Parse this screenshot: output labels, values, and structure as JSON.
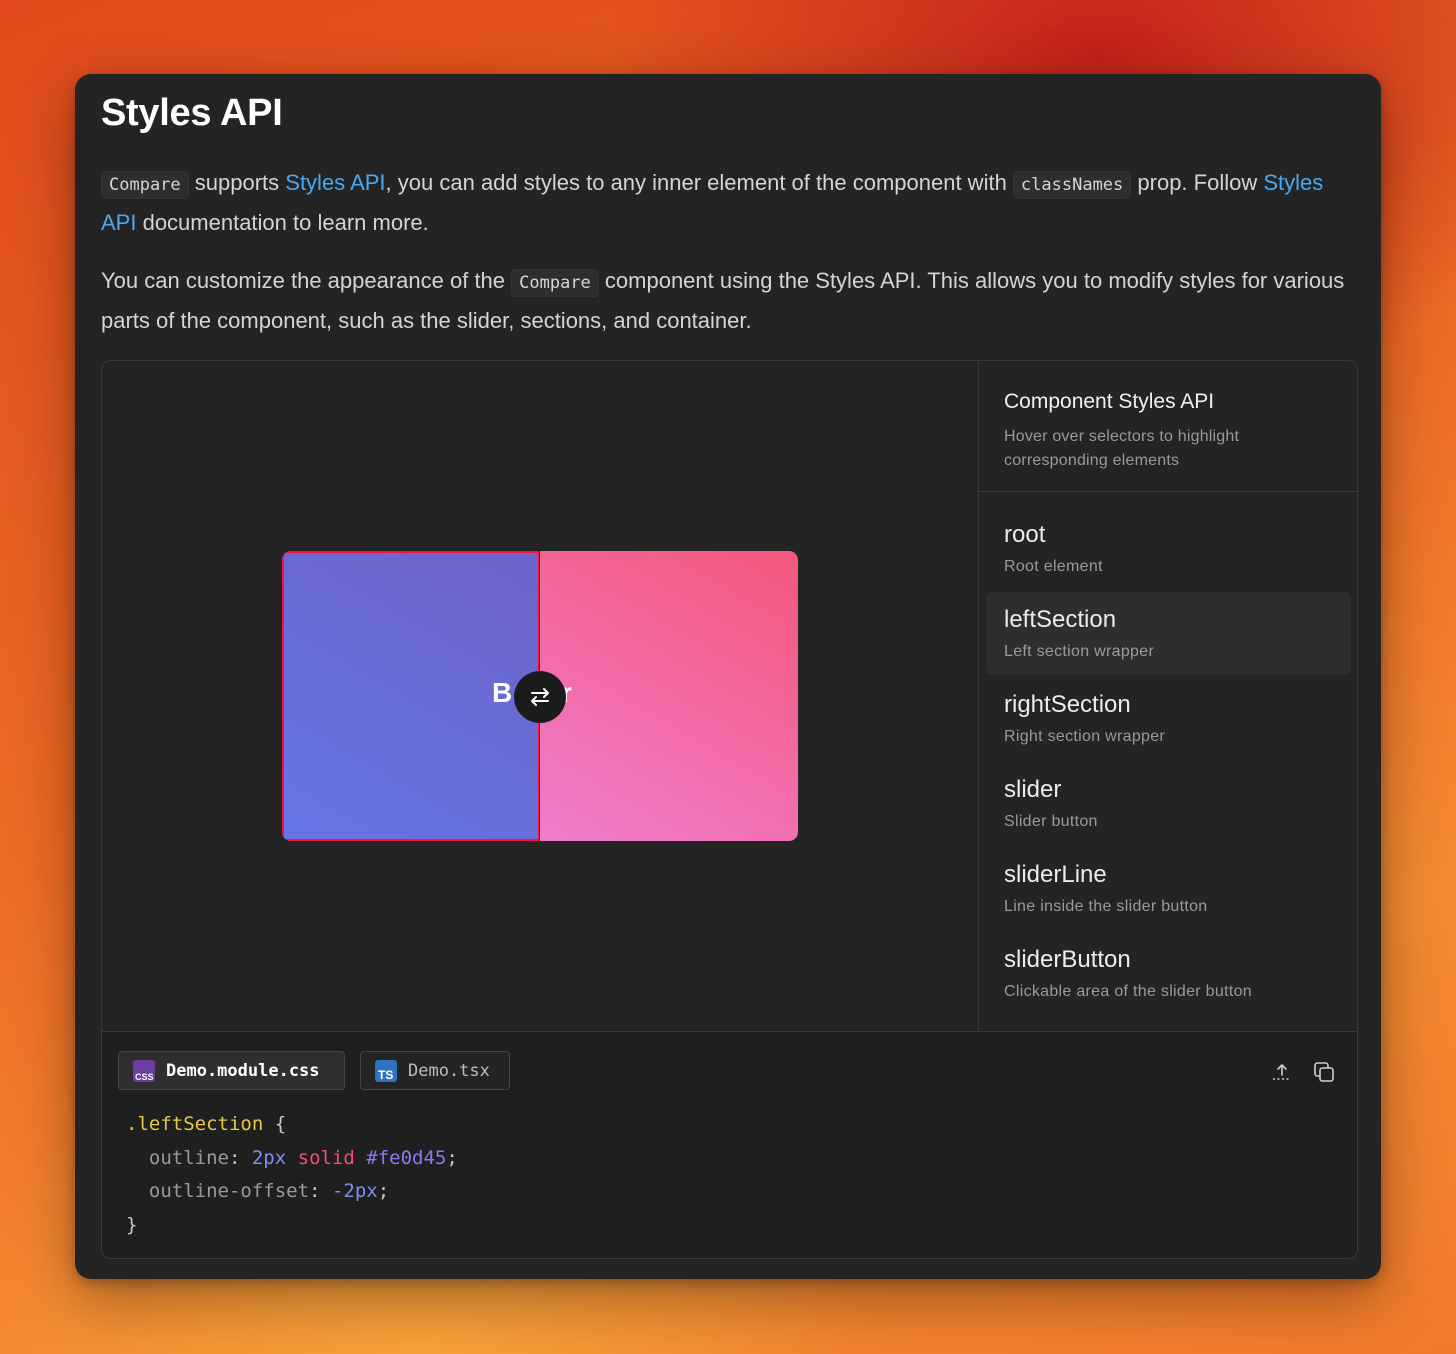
{
  "page": {
    "title": "Styles API",
    "p1": {
      "code1": "Compare",
      "t1": " supports ",
      "link1": "Styles API",
      "t2": ", you can add styles to any inner element of the component with ",
      "code2": "classNames",
      "t3": " prop. Follow ",
      "link2": "Styles API",
      "t4": " documentation to learn more."
    },
    "p2": {
      "t1": "You can customize the appearance of the ",
      "code1": "Compare",
      "t2": " component using the Styles API. This allows you to modify styles for various parts of the component, such as the slider, sections, and container."
    }
  },
  "preview": {
    "before_text": "B",
    "after_text": "r"
  },
  "styles_panel": {
    "title": "Component Styles API",
    "subtitle": "Hover over selectors to highlight corresponding elements",
    "selectors": [
      {
        "name": "root",
        "desc": "Root element"
      },
      {
        "name": "leftSection",
        "desc": "Left section wrapper"
      },
      {
        "name": "rightSection",
        "desc": "Right section wrapper"
      },
      {
        "name": "slider",
        "desc": "Slider button"
      },
      {
        "name": "sliderLine",
        "desc": "Line inside the slider button"
      },
      {
        "name": "sliderButton",
        "desc": "Clickable area of the slider button"
      }
    ],
    "active_selector": "leftSection"
  },
  "code_panel": {
    "tabs": [
      {
        "label": "Demo.module.css",
        "icon": "css-file-icon",
        "active": true
      },
      {
        "label": "Demo.tsx",
        "icon": "ts-file-icon",
        "active": false
      }
    ],
    "icons": {
      "share": "share-icon",
      "copy": "copy-icon"
    },
    "code": {
      "l1_sel": ".leftSection",
      "l1_brace": " {",
      "l2_prop": "outline",
      "l2_colon": ": ",
      "l2_num": "2px",
      "l2_kw": "solid",
      "l2_hex": "#fe0d45",
      "l2_end": ";",
      "l3_prop": "outline-offset",
      "l3_colon": ": ",
      "l3_num": "-2px",
      "l3_end": ";",
      "l4": "}"
    }
  },
  "colors": {
    "outline": "#fe0d45",
    "link": "#4aa8f0",
    "left_gradient": [
      "#6576e8",
      "#6d63c6"
    ],
    "right_gradient": [
      "#f07dcd",
      "#f4577a"
    ]
  }
}
